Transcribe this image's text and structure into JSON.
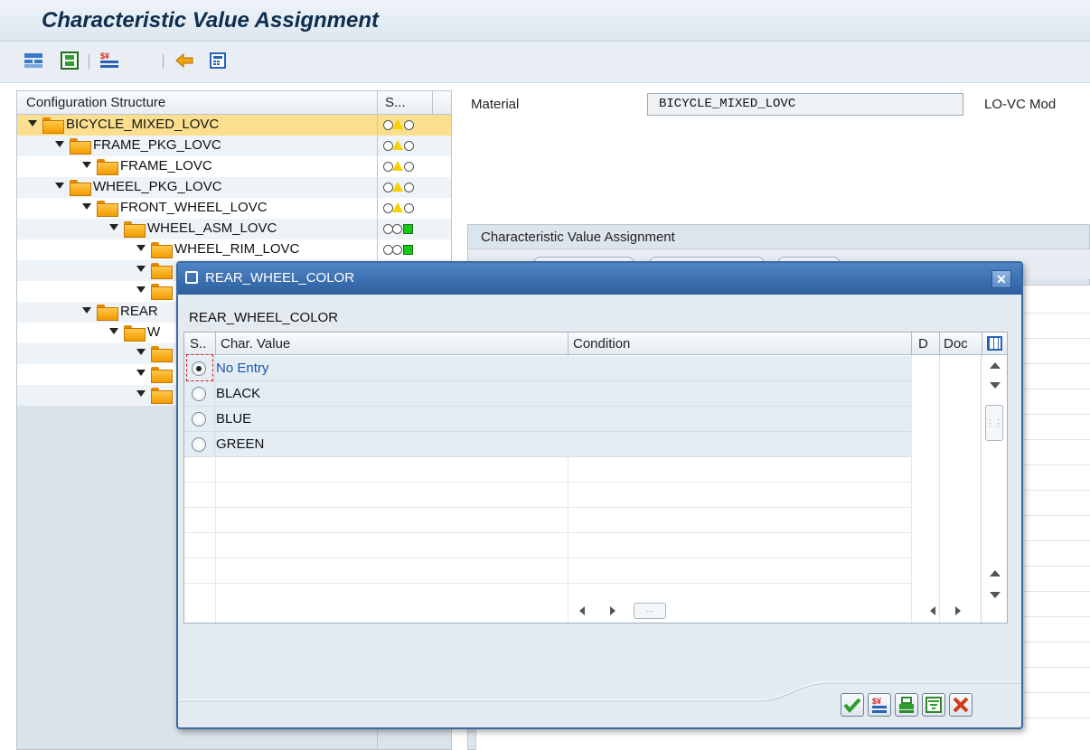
{
  "window": {
    "title": "Characteristic Value Assignment"
  },
  "toolbar": {
    "icons": [
      "structure-list-icon",
      "save-config-icon",
      "price-icon",
      "arrow-refresh-icon",
      "calculator-icon"
    ]
  },
  "tree": {
    "col_structure": "Configuration Structure",
    "col_status": "S...",
    "items": [
      {
        "label": "BICYCLE_MIXED_LOVC",
        "status": "triangle"
      },
      {
        "label": "FRAME_PKG_LOVC",
        "status": "triangle"
      },
      {
        "label": "FRAME_LOVC",
        "status": "triangle"
      },
      {
        "label": "WHEEL_PKG_LOVC",
        "status": "triangle"
      },
      {
        "label": "FRONT_WHEEL_LOVC",
        "status": "triangle"
      },
      {
        "label": "WHEEL_ASM_LOVC",
        "status": "green"
      },
      {
        "label": "WHEEL_RIM_LOVC",
        "status": "green"
      },
      {
        "label": "REAR",
        "status": ""
      },
      {
        "label": "W",
        "status": ""
      }
    ]
  },
  "header": {
    "material_label": "Material",
    "material_value": "BICYCLE_MIXED_LOVC",
    "right_label": "LO-VC Mod"
  },
  "cva_panel": {
    "title": "Characteristic Value Assignment"
  },
  "dialog": {
    "title": "REAR_WHEEL_COLOR",
    "subtitle": "REAR_WHEEL_COLOR",
    "columns": {
      "sel": "S..",
      "value": "Char. Value",
      "condition": "Condition",
      "d": "D",
      "doc": "Doc"
    },
    "rows": [
      {
        "value": "No Entry",
        "selected": true
      },
      {
        "value": "BLACK",
        "selected": false
      },
      {
        "value": "BLUE",
        "selected": false
      },
      {
        "value": "GREEN",
        "selected": false
      }
    ],
    "buttons": [
      "confirm-icon",
      "price-icon",
      "print-icon",
      "filter-icon",
      "cancel-icon"
    ],
    "colors": {
      "confirm": "#2f9e2f",
      "cancel": "#d33a1c",
      "link": "#1a56a8"
    }
  }
}
